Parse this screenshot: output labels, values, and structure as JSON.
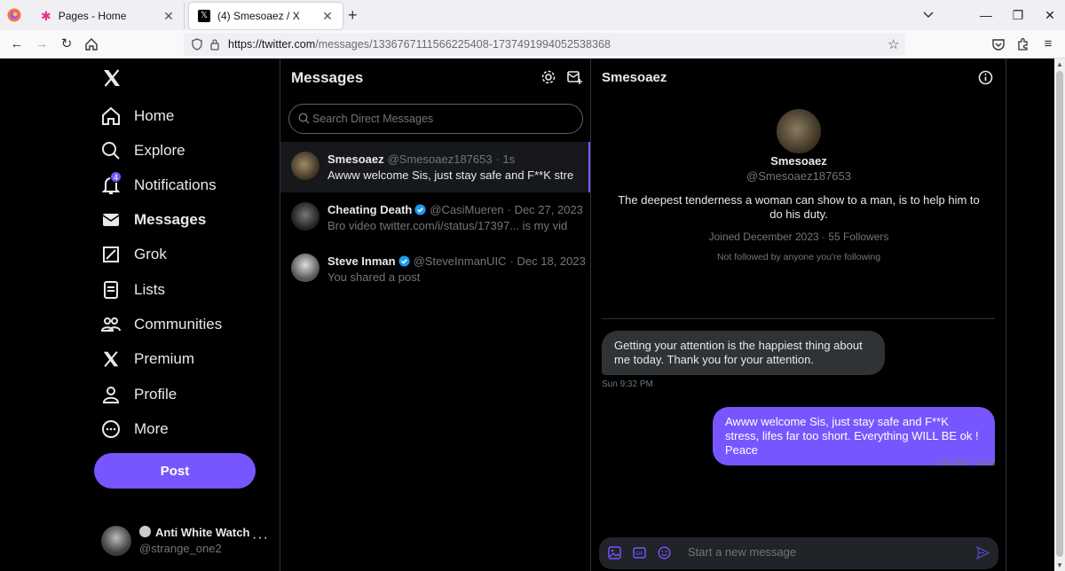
{
  "browser": {
    "tabs": [
      {
        "title": "Pages - Home"
      },
      {
        "title": "(4) Smesoaez / X"
      }
    ],
    "url_host": "https://twitter.com",
    "url_path": "/messages/1336767111566225408-1737491994052538368"
  },
  "sidebar": {
    "nav": [
      {
        "label": "Home",
        "icon": "home-icon"
      },
      {
        "label": "Explore",
        "icon": "search-icon"
      },
      {
        "label": "Notifications",
        "icon": "bell-icon",
        "badge": "4"
      },
      {
        "label": "Messages",
        "icon": "envelope-icon"
      },
      {
        "label": "Grok",
        "icon": "grok-icon"
      },
      {
        "label": "Lists",
        "icon": "list-icon"
      },
      {
        "label": "Communities",
        "icon": "people-icon"
      },
      {
        "label": "Premium",
        "icon": "x-icon"
      },
      {
        "label": "Profile",
        "icon": "person-icon"
      },
      {
        "label": "More",
        "icon": "more-circle-icon"
      }
    ],
    "post_label": "Post",
    "account": {
      "name": "Anti White Watch",
      "handle": "@strange_one2"
    }
  },
  "messages": {
    "title": "Messages",
    "search_placeholder": "Search Direct Messages",
    "conversations": [
      {
        "name": "Smesoaez",
        "handle": "@Smesoaez187653",
        "time": "· 1s",
        "preview": "Awww welcome Sis, just stay safe and F**K stre",
        "verified": false
      },
      {
        "name": "Cheating Death",
        "handle": "@CasiMueren",
        "time": "· Dec 27, 2023",
        "preview": "Bro video twitter.com/i/status/17397... is my vid",
        "verified": true
      },
      {
        "name": "Steve Inman",
        "handle": "@SteveInmanUIC",
        "time": "· Dec 18, 2023",
        "preview": "You shared a post",
        "verified": true
      }
    ]
  },
  "chat": {
    "title": "Smesoaez",
    "profile": {
      "name": "Smesoaez",
      "handle": "@Smesoaez187653",
      "bio": "The deepest tenderness a woman can show to a man, is to help him to do his duty.",
      "meta": "Joined December 2023 · 55 Followers",
      "followers_note": "Not followed by anyone you're following"
    },
    "messages": [
      {
        "text": "Getting your attention is the happiest thing about me today. Thank you for your attention.",
        "time": "Sun 9:32 PM"
      },
      {
        "text": "Awww welcome Sis, just stay safe and F**K stress, lifes far too short. Everything WILL BE ok ! Peace",
        "time": "9:25 AM · Sent"
      }
    ],
    "composer_placeholder": "Start a new message"
  },
  "colors": {
    "accent": "#7856ff",
    "verified": "#1d9bf0",
    "muted": "#71767b",
    "border": "#2f3336"
  }
}
